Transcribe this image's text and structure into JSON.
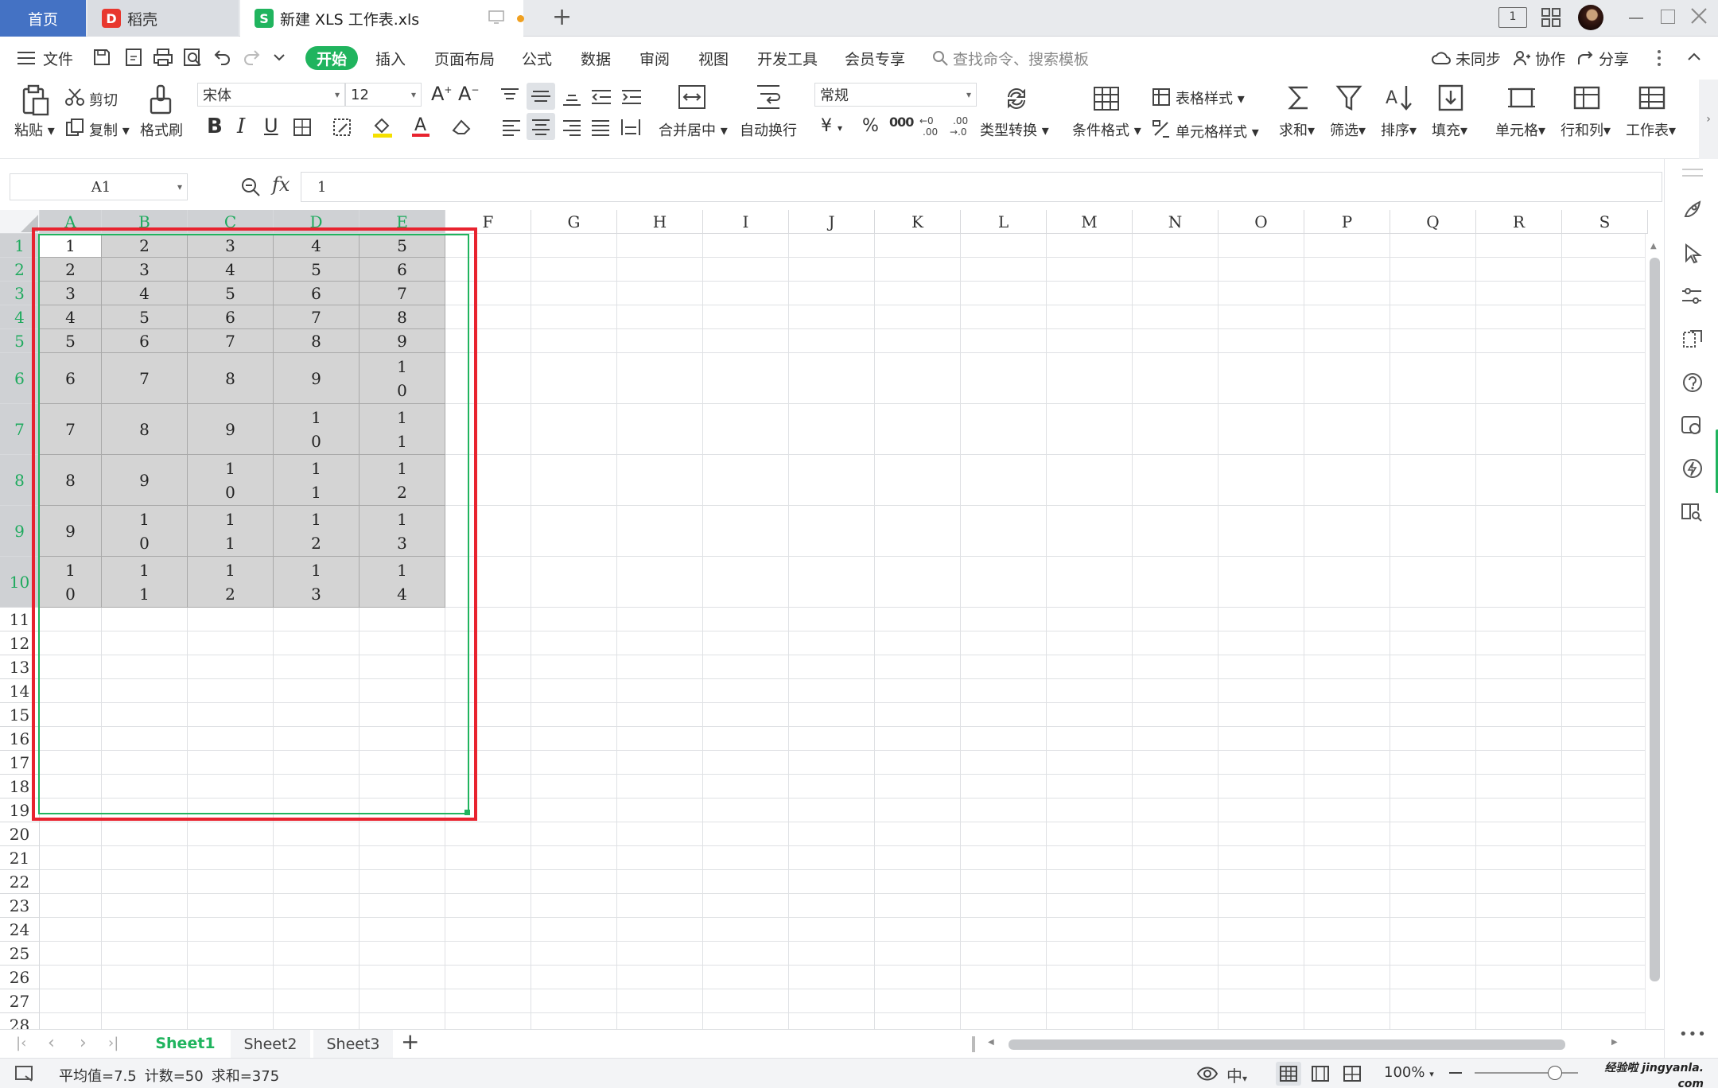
{
  "titlebar": {
    "tabs": [
      {
        "label": "首页"
      },
      {
        "label": "稻壳"
      },
      {
        "label": "新建 XLS 工作表.xls"
      }
    ],
    "new_tab": "+",
    "page_indicator": "1"
  },
  "menubar": {
    "file": "文件",
    "items": [
      "开始",
      "插入",
      "页面布局",
      "公式",
      "数据",
      "审阅",
      "视图",
      "开发工具",
      "会员专享"
    ],
    "search_placeholder": "查找命令、搜索模板",
    "sync": "未同步",
    "collab": "协作",
    "share": "分享"
  },
  "ribbon": {
    "paste": "粘贴",
    "cut": "剪切",
    "copy": "复制",
    "format_painter": "格式刷",
    "font_name": "宋体",
    "font_size": "12",
    "merge_center": "合并居中",
    "wrap_text": "自动换行",
    "number_format": "常规",
    "type_convert": "类型转换",
    "conditional_format": "条件格式",
    "table_style": "表格样式",
    "cell_style": "单元格样式",
    "sum": "求和",
    "filter": "筛选",
    "sort": "排序",
    "fill": "填充",
    "cell": "单元格",
    "row_col": "行和列",
    "worksheet": "工作表",
    "currency_symbol": "¥",
    "percent": "%",
    "thousands": "000"
  },
  "formulabar": {
    "name_box": "A1",
    "fx": "fx",
    "value": "1"
  },
  "grid": {
    "columns": [
      "A",
      "B",
      "C",
      "D",
      "E",
      "F",
      "G",
      "H",
      "I",
      "J",
      "K",
      "L",
      "M",
      "N",
      "O",
      "P",
      "Q",
      "R",
      "S"
    ],
    "rows": [
      "1",
      "2",
      "3",
      "4",
      "5",
      "6",
      "7",
      "8",
      "9",
      "10",
      "11",
      "12",
      "13",
      "14",
      "15",
      "16",
      "17",
      "18",
      "19",
      "20",
      "21",
      "22",
      "23",
      "24",
      "25",
      "26",
      "27",
      "28"
    ],
    "data": [
      [
        "1",
        "2",
        "3",
        "4",
        "5"
      ],
      [
        "2",
        "3",
        "4",
        "5",
        "6"
      ],
      [
        "3",
        "4",
        "5",
        "6",
        "7"
      ],
      [
        "4",
        "5",
        "6",
        "7",
        "8"
      ],
      [
        "5",
        "6",
        "7",
        "8",
        "9"
      ],
      [
        "6",
        "7",
        "8",
        "9",
        "1\n0"
      ],
      [
        "7",
        "8",
        "9",
        "1\n0",
        "1\n1"
      ],
      [
        "8",
        "9",
        "1\n0",
        "1\n1",
        "1\n2"
      ],
      [
        "9",
        "1\n0",
        "1\n1",
        "1\n2",
        "1\n3"
      ],
      [
        "1\n0",
        "1\n1",
        "1\n2",
        "1\n3",
        "1\n4"
      ]
    ],
    "active_cell": "A1"
  },
  "sheets": {
    "tabs": [
      "Sheet1",
      "Sheet2",
      "Sheet3"
    ],
    "active": "Sheet1",
    "add": "+"
  },
  "status": {
    "average": "平均值=7.5",
    "count": "计数=50",
    "sum": "求和=375",
    "zoom": "100%"
  },
  "watermark": "经验啦 jingyanla.com",
  "colors": {
    "accent_green": "#20b45e",
    "home_tab_blue": "#4472c4",
    "highlight_red": "#e8232f",
    "selection_gray": "#d4d4d4"
  }
}
